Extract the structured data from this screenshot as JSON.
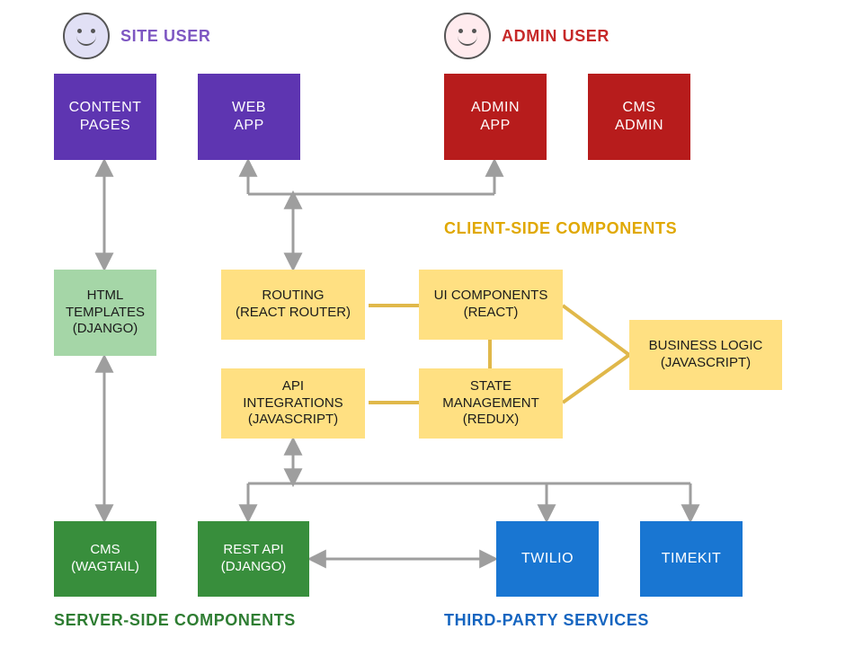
{
  "users": {
    "site": "SITE USER",
    "admin": "ADMIN USER"
  },
  "sections": {
    "client": "CLIENT-SIDE COMPONENTS",
    "server": "SERVER-SIDE COMPONENTS",
    "thirdparty": "THIRD-PARTY SERVICES"
  },
  "boxes": {
    "content_pages": "CONTENT\nPAGES",
    "web_app": "WEB\nAPP",
    "admin_app": "ADMIN\nAPP",
    "cms_admin": "CMS\nADMIN",
    "html_templates": "HTML\nTEMPLATES\n(DJANGO)",
    "routing": "ROUTING\n(REACT ROUTER)",
    "ui_components": "UI COMPONENTS\n(REACT)",
    "business_logic": "BUSINESS LOGIC\n(JAVASCRIPT)",
    "api_integrations": "API\nINTEGRATIONS\n(JAVASCRIPT)",
    "state_mgmt": "STATE\nMANAGEMENT\n(REDUX)",
    "cms": "CMS\n(WAGTAIL)",
    "rest_api": "REST API\n(DJANGO)",
    "twilio": "TWILIO",
    "timekit": "TIMEKIT"
  },
  "colors": {
    "arrow": "#9E9E9E",
    "yellow_line": "#E0B84A"
  }
}
